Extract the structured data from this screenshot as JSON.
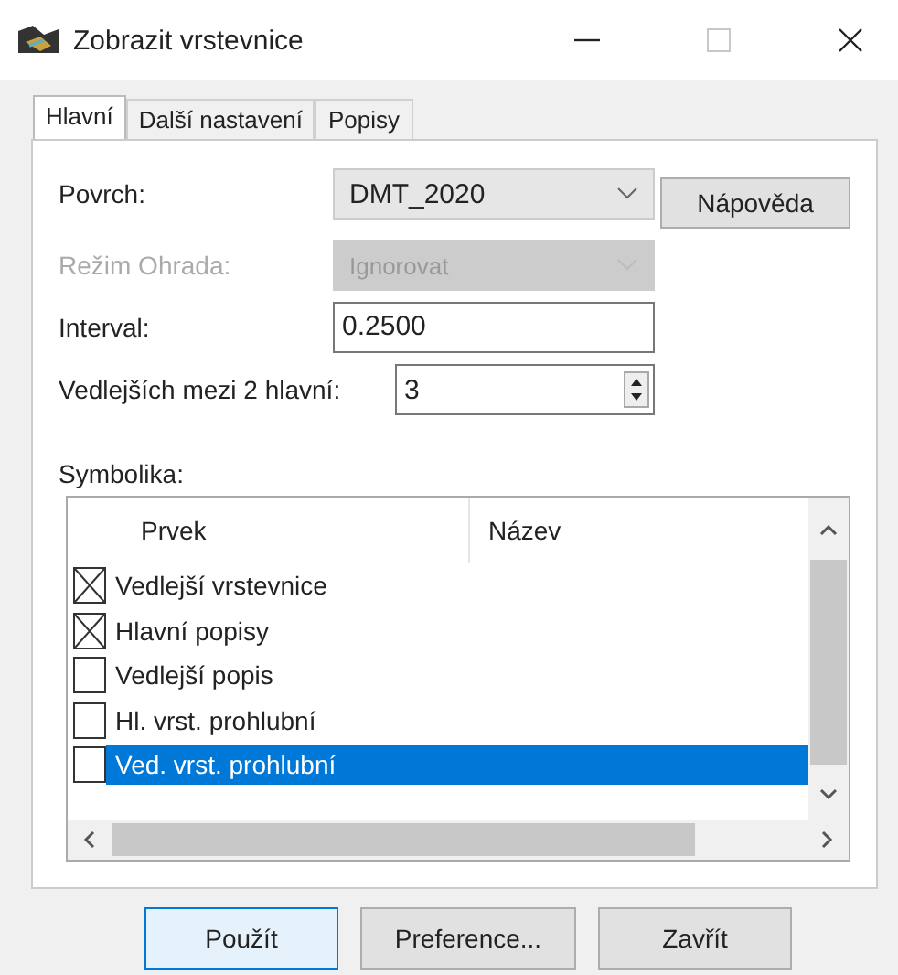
{
  "window": {
    "title": "Zobrazit vrstevnice"
  },
  "tabs": [
    {
      "label": "Hlavní",
      "selected": true
    },
    {
      "label": "Další nastavení",
      "selected": false
    },
    {
      "label": "Popisy",
      "selected": false
    }
  ],
  "fields": [
    {
      "kind": "combo",
      "label": "Povrch:",
      "value": "DMT_2020",
      "disabled": false
    },
    {
      "kind": "combo",
      "label": "Režim Ohrada:",
      "value": "Ignorovat",
      "disabled": true
    },
    {
      "kind": "text",
      "label": "Interval:",
      "value": "0.2500",
      "disabled": false
    },
    {
      "kind": "spin",
      "label": "Vedlejších mezi 2 hlavní:",
      "value": "3",
      "disabled": false
    }
  ],
  "help_button": "Nápověda",
  "symbolika": {
    "label": "Symbolika:",
    "columns": [
      "Prvek",
      "Název"
    ],
    "rows": [
      {
        "name": "Vedlejší vrstevnice",
        "checked": true,
        "selected": false
      },
      {
        "name": "Hlavní popisy",
        "checked": true,
        "selected": false
      },
      {
        "name": "Vedlejší popis",
        "checked": false,
        "selected": false
      },
      {
        "name": "Hl. vrst. prohlubní",
        "checked": false,
        "selected": false
      },
      {
        "name": "Ved. vrst. prohlubní",
        "checked": false,
        "selected": true
      }
    ]
  },
  "buttons": [
    {
      "label": "Použít",
      "focused": true
    },
    {
      "label": "Preference...",
      "focused": false
    },
    {
      "label": "Zavřít",
      "focused": false
    }
  ]
}
